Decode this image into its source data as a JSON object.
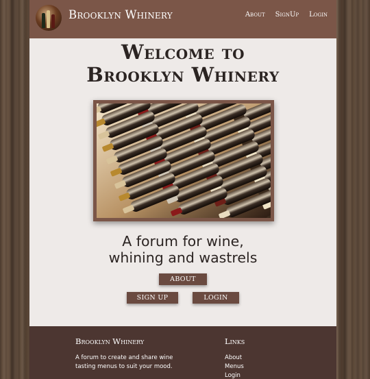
{
  "navbar": {
    "brand": "Brooklyn Whinery",
    "links": [
      "About",
      "SignUp",
      "Login"
    ]
  },
  "main": {
    "headline_line1": "Welcome to",
    "headline_line2": "Brooklyn Whinery",
    "tagline_line1": "A forum for wine,",
    "tagline_line2": "whining and wastrels",
    "buttons": {
      "about": "ABOUT",
      "signup": "SIGN UP",
      "login": "LOGIN"
    }
  },
  "footer": {
    "brand": "Brooklyn Whinery",
    "description": "A forum to create and share wine tasting menus to suit your mood.",
    "links_title": "Links",
    "links": [
      "About",
      "Menus",
      "Login"
    ]
  },
  "colors": {
    "nav_bg": "#7b5648",
    "button_bg": "#6a4a40",
    "footer_bg": "#4c3631",
    "page_bg": "#eeeae8"
  },
  "icons": {
    "logo": "wine-bottles-logo",
    "hero": "wine-rack-photo"
  }
}
